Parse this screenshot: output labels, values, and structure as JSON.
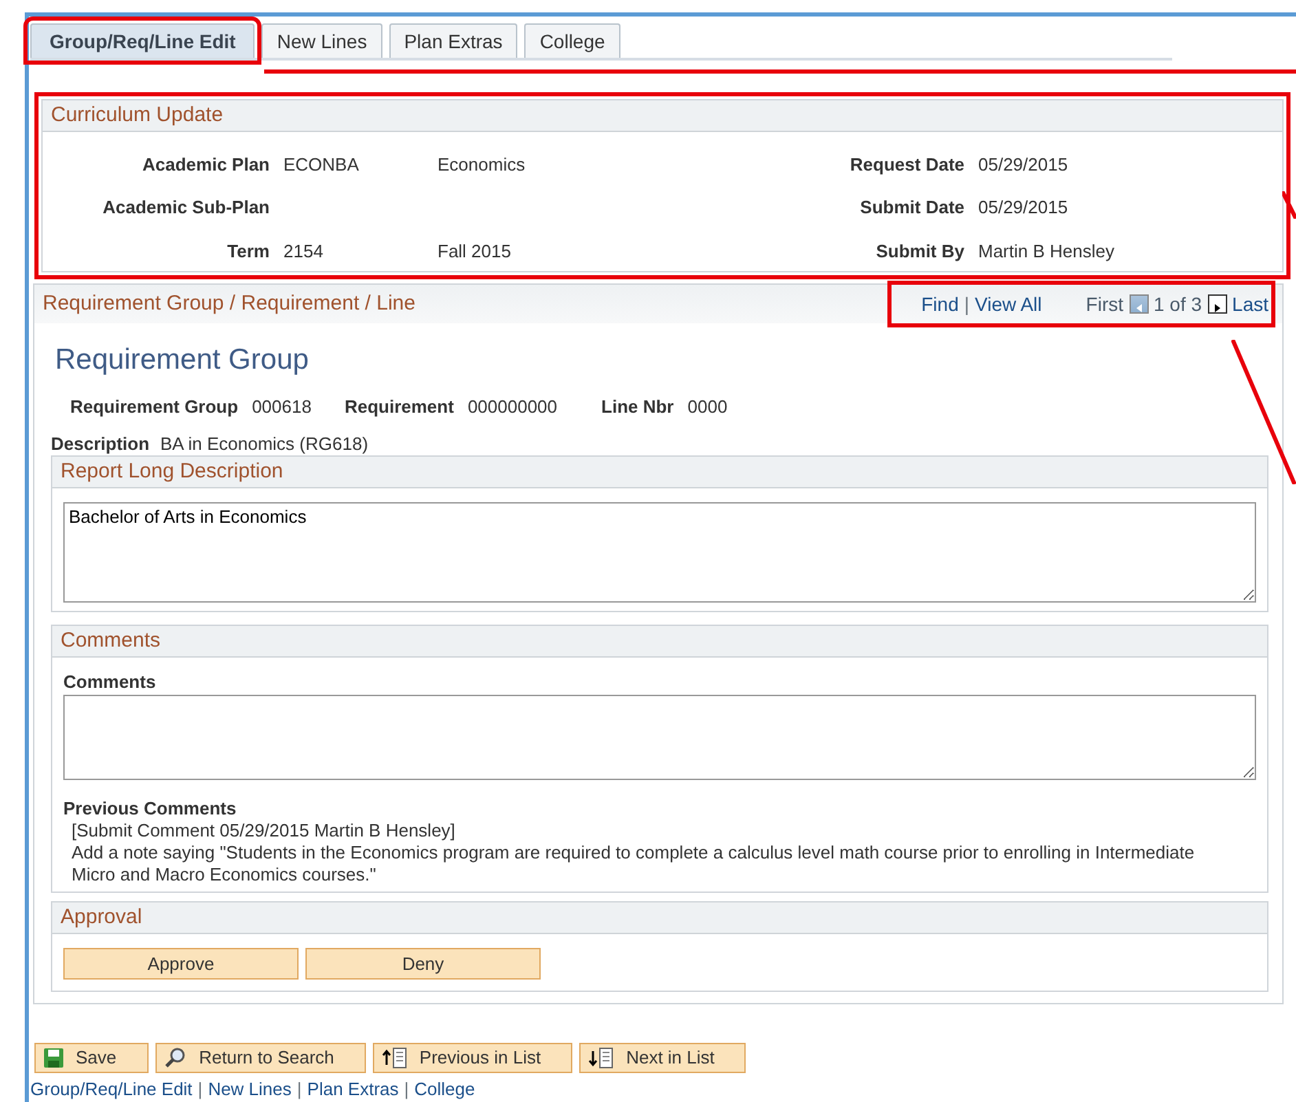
{
  "tabs": [
    {
      "label": "Group/Req/Line Edit",
      "selected": true
    },
    {
      "label": "New Lines",
      "selected": false
    },
    {
      "label": "Plan Extras",
      "selected": false
    },
    {
      "label": "College",
      "selected": false
    }
  ],
  "curriculum": {
    "title": "Curriculum Update",
    "rows": [
      {
        "label": "Academic Plan",
        "code": "ECONBA",
        "desc": "Economics",
        "right_label": "Request Date",
        "right_value": "05/29/2015"
      },
      {
        "label": "Academic Sub-Plan",
        "right_label": "Submit Date",
        "right_value": "05/29/2015"
      },
      {
        "label": "Term",
        "code": "2154",
        "desc": "Fall 2015",
        "right_label": "Submit By",
        "right_value": "Martin B Hensley"
      }
    ]
  },
  "requirement": {
    "title": "Requirement Group / Requirement / Line",
    "nav": {
      "find": "Find",
      "separator": "|",
      "view_all": "View All",
      "first": "First",
      "position": "1 of 3",
      "last": "Last"
    },
    "heading": "Requirement Group",
    "fields": [
      {
        "label": "Requirement Group",
        "value": "000618"
      },
      {
        "label": "Requirement",
        "value": "000000000"
      },
      {
        "label": "Line Nbr",
        "value": "0000"
      }
    ],
    "description": {
      "label": "Description",
      "value": "BA in Economics (RG618)"
    },
    "long_description": {
      "title": "Report Long Description",
      "value": "Bachelor of Arts in Economics"
    },
    "comments": {
      "title": "Comments",
      "label": "Comments",
      "previous_label": "Previous Comments",
      "previous_header": "[Submit Comment 05/29/2015 Martin B Hensley]",
      "previous_text": "Add a note saying \"Students in the Economics program are required to complete a calculus level math course prior to enrolling in Intermediate Micro and Macro Economics courses.\""
    },
    "approval": {
      "title": "Approval",
      "buttons": [
        "Approve",
        "Deny"
      ]
    }
  },
  "toolbar": [
    {
      "kind": "save",
      "label": "Save"
    },
    {
      "kind": "search",
      "label": "Return to Search"
    },
    {
      "kind": "previous",
      "label": "Previous in List"
    },
    {
      "kind": "next",
      "label": "Next in List"
    }
  ],
  "footer_links": [
    "Group/Req/Line Edit",
    "New Lines",
    "Plan Extras",
    "College"
  ],
  "footer_separator": "|"
}
